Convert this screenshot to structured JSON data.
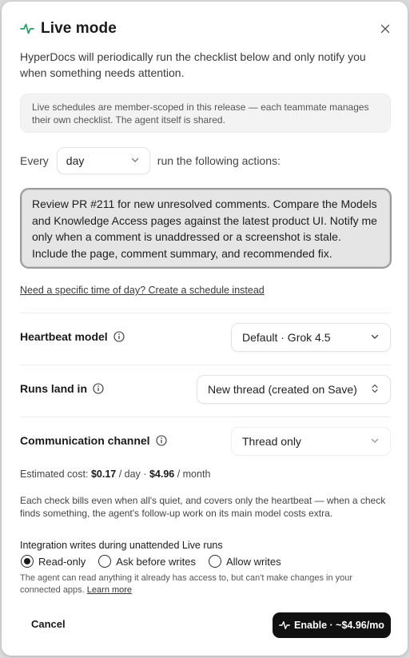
{
  "dialog": {
    "title": "Live mode",
    "accent_color": "#1f9d63",
    "intro": "HyperDocs will periodically run the checklist below and only notify you when something needs attention.",
    "notice": "Live schedules are member-scoped in this release — each teammate manages their own checklist. The agent itself is shared.",
    "every": {
      "prefix": "Every",
      "value": "day",
      "suffix": "run the following actions:"
    },
    "prompt": "Review PR #211 for new unresolved comments. Compare the Models and Knowledge Access pages against the latest product UI. Notify me only when a comment is unaddressed or a screenshot is stale. Include the page, comment summary, and recommended fix.",
    "schedule_link": "Need a specific time of day? Create a schedule instead",
    "heartbeat": {
      "label": "Heartbeat model",
      "value": "Default · Grok 4.5"
    },
    "runs_land": {
      "label": "Runs land in",
      "value": "New thread (created on Save)"
    },
    "channel": {
      "label": "Communication channel",
      "value": "Thread only"
    },
    "cost": {
      "prefix": "Estimated cost:",
      "per_day": "$0.17",
      "day_unit": "/ day ·",
      "per_month": "$4.96",
      "month_unit": "/ month"
    },
    "billing_note": "Each check bills even when all's quiet, and covers only the heartbeat — when a check finds something, the agent's follow-up work on its main model costs extra.",
    "writes": {
      "title": "Integration writes during unattended Live runs",
      "options": [
        "Read-only",
        "Ask before writes",
        "Allow writes"
      ],
      "selected": "Read-only",
      "note": "The agent can read anything it already has access to, but can't make changes in your connected apps.",
      "learn_more": "Learn more"
    },
    "cancel_label": "Cancel",
    "enable_label": "Enable · ~$4.96/mo",
    "icons": {
      "title_icon": "activity-pulse-icon",
      "close_icon": "close-icon",
      "chevron": "chevron-down-icon",
      "updown": "chevron-up-down-icon",
      "info": "info-icon"
    }
  }
}
